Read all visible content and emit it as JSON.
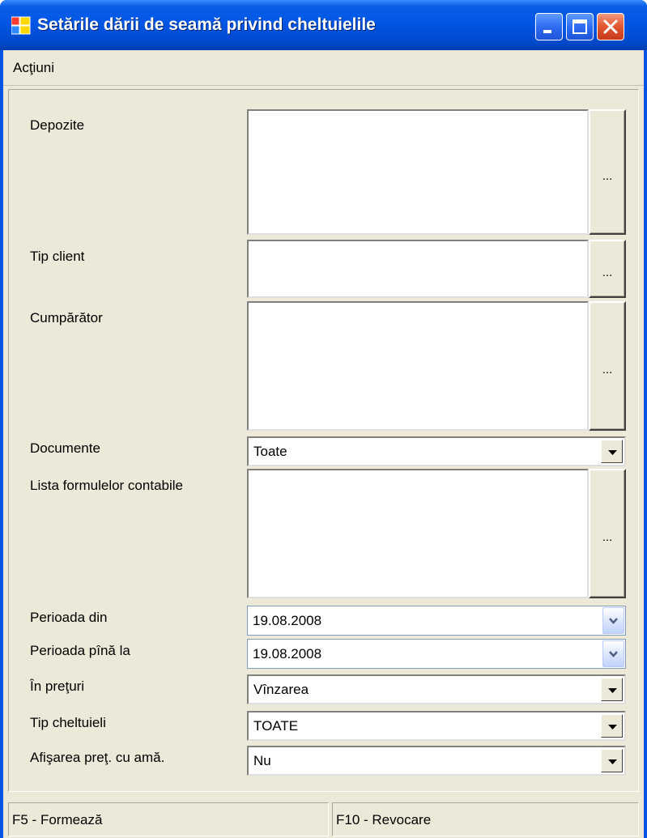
{
  "window": {
    "title": "Setările dării de seamă privind cheltuielile",
    "icon": "app-window-icon",
    "controls": [
      "minimize-icon",
      "maximize-icon",
      "close-icon"
    ]
  },
  "menu": {
    "actions": "Acţiuni"
  },
  "form": {
    "depozite": {
      "label": "Depozite",
      "value": "",
      "button": "..."
    },
    "tip_client": {
      "label": "Tip client",
      "value": "",
      "button": "..."
    },
    "cumparator": {
      "label": "Cumpărător",
      "value": "",
      "button": "..."
    },
    "documente": {
      "label": "Documente",
      "value": "Toate"
    },
    "lista_formule": {
      "label": "Lista formulelor contabile",
      "value": "",
      "button": "..."
    },
    "perioada_din": {
      "label": "Perioada din",
      "value": "19.08.2008"
    },
    "perioada_pina": {
      "label": "Perioada pînă la",
      "value": "19.08.2008"
    },
    "in_preturi": {
      "label": "În  preţuri",
      "value": "Vînzarea"
    },
    "tip_cheltuieli": {
      "label": "Tip cheltuieli",
      "value": "TOATE"
    },
    "afisarea": {
      "label": "Afişarea preţ. cu amă.",
      "value": "Nu"
    }
  },
  "status": {
    "left": "F5 - Formează",
    "right": "F10 - Revocare"
  },
  "colors": {
    "titlebar": "#0054e3",
    "face": "#ece9d8",
    "close": "#e35a35"
  }
}
